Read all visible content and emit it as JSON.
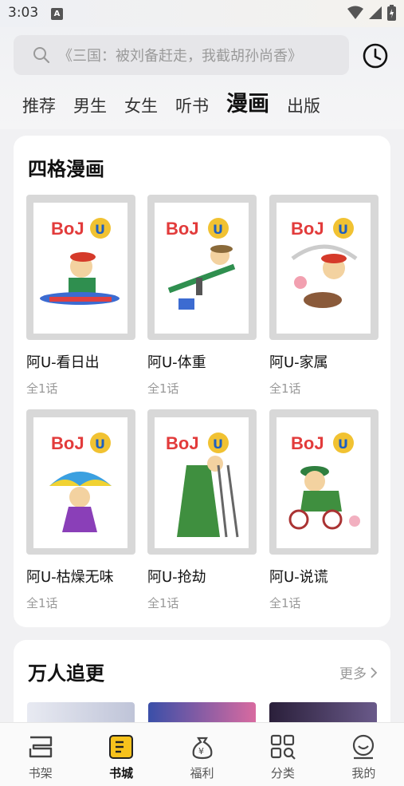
{
  "status": {
    "time": "3:03",
    "notif_letter": "A"
  },
  "search": {
    "placeholder": "《三国：被刘备赶走，我截胡孙尚香》"
  },
  "tabs": [
    {
      "label": "推荐",
      "active": false
    },
    {
      "label": "男生",
      "active": false
    },
    {
      "label": "女生",
      "active": false
    },
    {
      "label": "听书",
      "active": false
    },
    {
      "label": "漫画",
      "active": true
    },
    {
      "label": "出版",
      "active": false
    }
  ],
  "section1": {
    "title": "四格漫画",
    "items": [
      {
        "title": "阿U-看日出",
        "sub": "全1话"
      },
      {
        "title": "阿U-体重",
        "sub": "全1话"
      },
      {
        "title": "阿U-家属",
        "sub": "全1话"
      },
      {
        "title": "阿U-枯燥无味",
        "sub": "全1话"
      },
      {
        "title": "阿U-抢劫",
        "sub": "全1话"
      },
      {
        "title": "阿U-说谎",
        "sub": "全1话"
      }
    ]
  },
  "section2": {
    "title": "万人追更",
    "more": "更多"
  },
  "nav": [
    {
      "label": "书架",
      "icon": "bookshelf-icon",
      "active": false
    },
    {
      "label": "书城",
      "icon": "bookstore-icon",
      "active": true
    },
    {
      "label": "福利",
      "icon": "money-bag-icon",
      "active": false
    },
    {
      "label": "分类",
      "icon": "category-icon",
      "active": false
    },
    {
      "label": "我的",
      "icon": "smiley-profile-icon",
      "active": false
    }
  ],
  "colors": {
    "accent": "#f6c21c",
    "text": "#111111",
    "muted": "#999999",
    "background": "#f1f1f3"
  }
}
